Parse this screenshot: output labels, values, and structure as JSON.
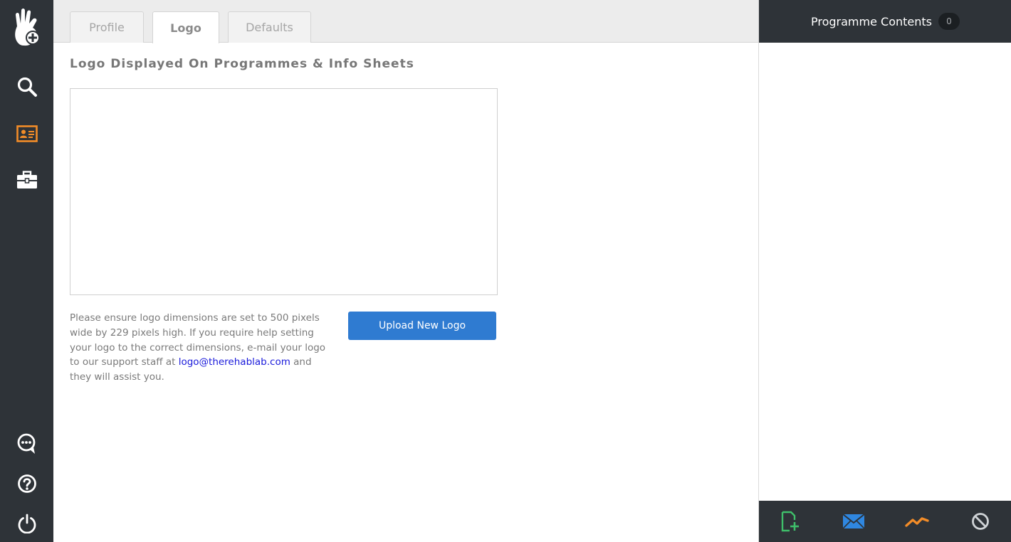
{
  "colors": {
    "nav_bg": "#2e3338",
    "accent_orange": "#f28c28",
    "primary_blue": "#2f7bd1",
    "link_blue": "#1a1adb",
    "add_green": "#3fbf6a"
  },
  "leftnav": {
    "items": [
      {
        "name": "app-logo-icon",
        "icon": "hand-plus-icon"
      },
      {
        "name": "search-icon",
        "icon": "search-icon"
      },
      {
        "name": "profile-card-icon",
        "icon": "id-card-icon",
        "active": true
      },
      {
        "name": "toolbox-icon",
        "icon": "briefcase-icon"
      },
      {
        "name": "chat-icon",
        "icon": "chat-bubble-icon"
      },
      {
        "name": "help-icon",
        "icon": "question-circle-icon"
      },
      {
        "name": "power-icon",
        "icon": "power-icon"
      }
    ]
  },
  "tabs": [
    {
      "label": "Profile",
      "active": false
    },
    {
      "label": "Logo",
      "active": true
    },
    {
      "label": "Defaults",
      "active": false
    }
  ],
  "main": {
    "section_title": "Logo Displayed On Programmes & Info Sheets",
    "help_text_before": "Please ensure logo dimensions are set to 500 pixels wide by 229 pixels high. If you require help setting your logo to the correct dimensions, e-mail your logo to our support staff at ",
    "help_email": "logo@therehablab.com",
    "help_text_after": " and they will assist you.",
    "upload_button_label": "Upload New Logo"
  },
  "rightpanel": {
    "title": "Programme Contents",
    "count": "0",
    "footer_actions": [
      {
        "name": "add-page-icon"
      },
      {
        "name": "email-icon"
      },
      {
        "name": "chart-line-icon"
      },
      {
        "name": "block-icon"
      }
    ]
  }
}
